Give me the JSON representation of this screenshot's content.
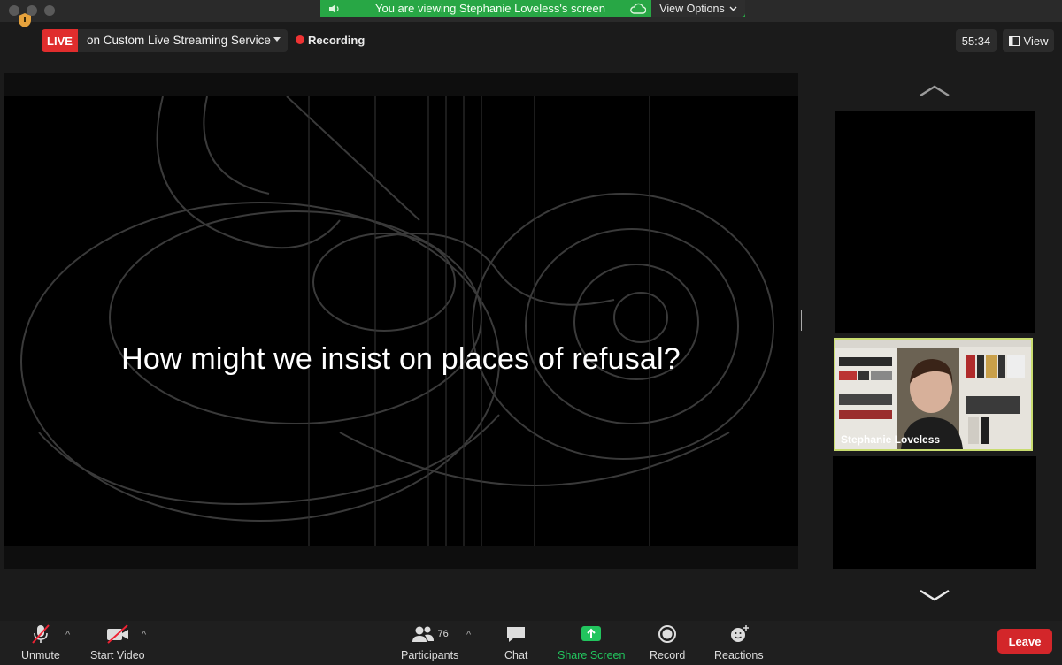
{
  "window": {
    "title": ""
  },
  "share_banner": {
    "text": "You are viewing Stephanie Loveless's screen",
    "view_options": "View Options"
  },
  "live": {
    "badge": "LIVE",
    "service": "on Custom Live Streaming Service"
  },
  "recording": {
    "label": "Recording"
  },
  "meeting": {
    "timer": "55:34",
    "view_label": "View"
  },
  "slide": {
    "text": "How might we insist on places of refusal?"
  },
  "participants_panel": {
    "active_speaker": "Stephanie Loveless",
    "highlight_color": "#c9dc70"
  },
  "toolbar": {
    "unmute": "Unmute",
    "start_video": "Start Video",
    "participants": "Participants",
    "participant_count": "76",
    "chat": "Chat",
    "share_screen": "Share Screen",
    "record": "Record",
    "reactions": "Reactions",
    "leave": "Leave",
    "share_color": "#22c55e",
    "leave_color": "#d3262a"
  }
}
